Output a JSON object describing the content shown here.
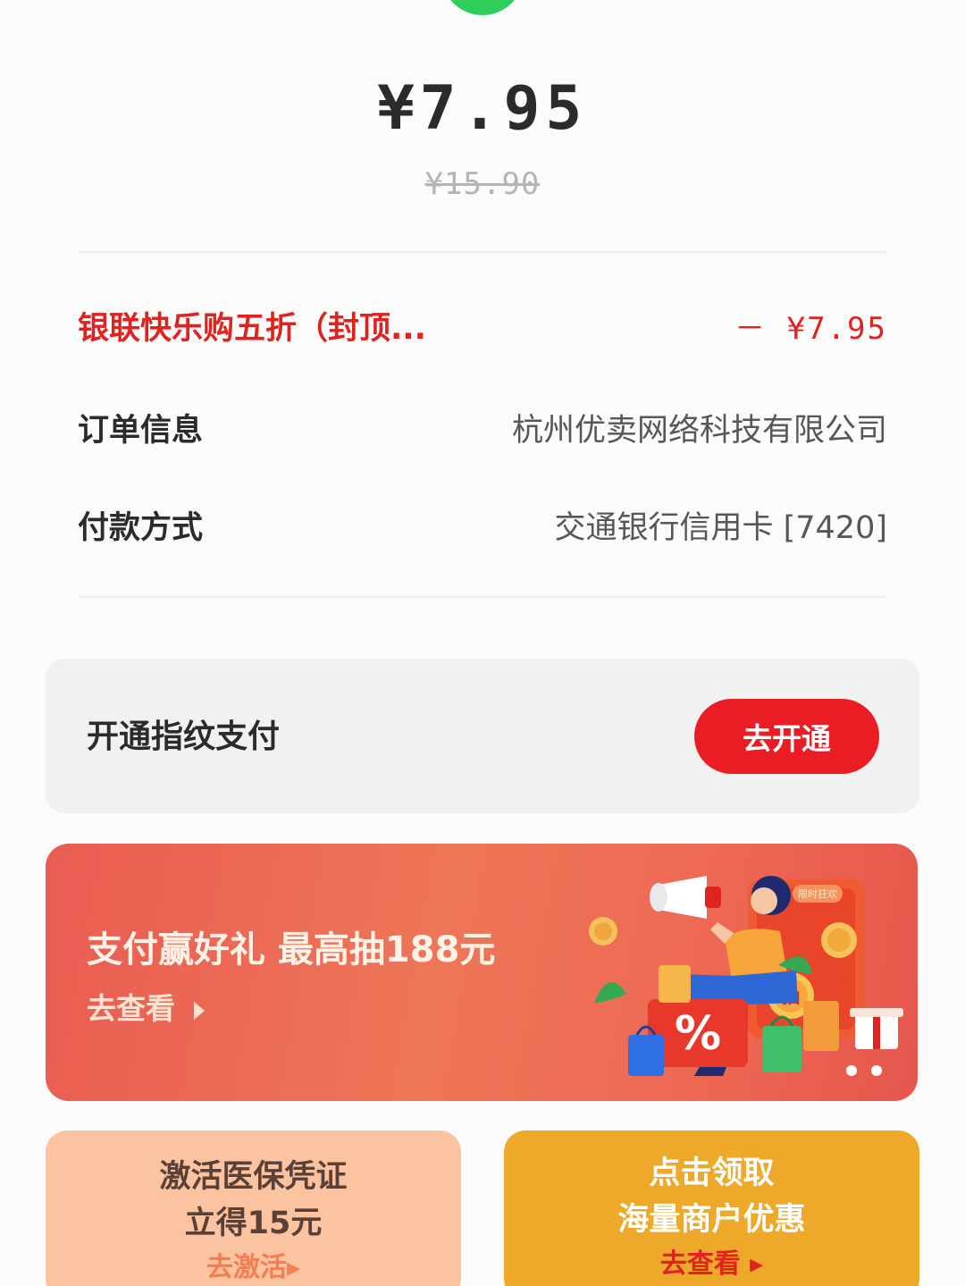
{
  "header": {
    "status_icon": "check-circle-icon",
    "status_color": "#2fcd5a"
  },
  "payment": {
    "amount": "¥7.95",
    "original_amount": "¥15.90"
  },
  "details": {
    "discount_label": "银联快乐购五折（封顶...",
    "discount_value": "－ ¥7.95",
    "order_label": "订单信息",
    "order_value": "杭州优卖网络科技有限公司",
    "method_label": "付款方式",
    "method_value": "交通银行信用卡 [7420]"
  },
  "fingerprint": {
    "title": "开通指纹支付",
    "button_label": "去开通",
    "button_color": "#ea1c24"
  },
  "banner": {
    "title": "支付赢好礼 最高抽188元",
    "link": "去查看",
    "link_icon": "triangle-right-icon",
    "art_badge": "限时狂欢",
    "art_draw": "抽",
    "art_percent": "%"
  },
  "tiles": [
    {
      "line1": "激活医保凭证",
      "line2": "立得15元",
      "link": "去激活▸",
      "background": "#fbc39f"
    },
    {
      "line1": "点击领取",
      "line2": "海量商户优惠",
      "link": "去查看 ▸",
      "background": "#eea82a"
    }
  ]
}
